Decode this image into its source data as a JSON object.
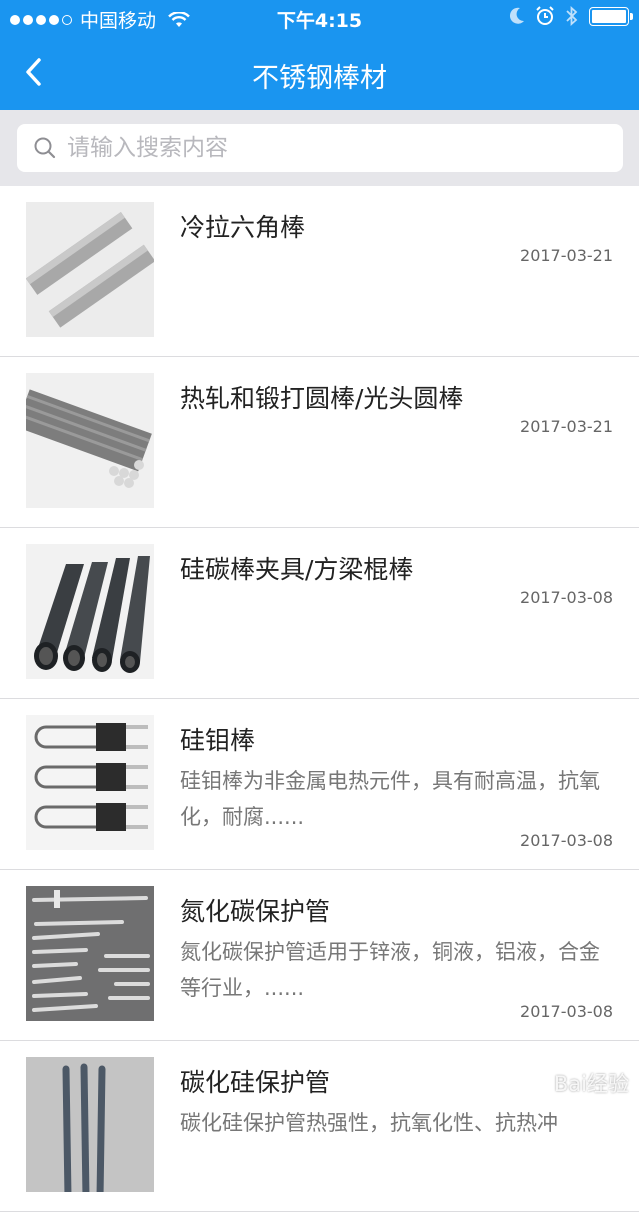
{
  "status": {
    "carrier": "中国移动",
    "time": "下午4:15"
  },
  "nav": {
    "title": "不锈钢棒材"
  },
  "search": {
    "placeholder": "请输入搜索内容"
  },
  "items": [
    {
      "title": "冷拉六角棒",
      "desc": "",
      "date": "2017-03-21"
    },
    {
      "title": "热轧和锻打圆棒/光头圆棒",
      "desc": "",
      "date": "2017-03-21"
    },
    {
      "title": "硅碳棒夹具/方梁棍棒",
      "desc": "",
      "date": "2017-03-08"
    },
    {
      "title": "硅钼棒",
      "desc": "硅钼棒为非金属电热元件，具有耐高温，抗氧化，耐腐......",
      "date": "2017-03-08"
    },
    {
      "title": "氮化碳保护管",
      "desc": "氮化碳保护管适用于锌液，铜液，铝液，合金等行业，......",
      "date": "2017-03-08"
    },
    {
      "title": "碳化硅保护管",
      "desc": "碳化硅保护管热强性，抗氧化性、抗热冲",
      "date": ""
    }
  ],
  "watermark": "Bai经验"
}
